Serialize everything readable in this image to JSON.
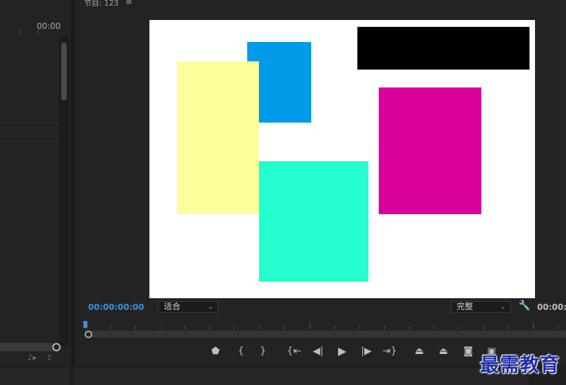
{
  "left_panel": {
    "ruler_time": "00:00",
    "icons": [
      "audio-to-track-icon",
      "export-icon"
    ]
  },
  "program": {
    "title": "节目: 123",
    "menu_icon": "hamburger-icon",
    "frame": {
      "background": "#ffffff",
      "rects": [
        {
          "name": "blue-rect",
          "color": "#009be8"
        },
        {
          "name": "yellow-rect",
          "color": "#fdfd9b"
        },
        {
          "name": "black-rect",
          "color": "#000000"
        },
        {
          "name": "magenta-rect",
          "color": "#d9009c"
        },
        {
          "name": "cyan-rect",
          "color": "#25ffcf"
        }
      ]
    },
    "timecode_left": "00:00:00:00",
    "zoom_select": "适合",
    "quality_select": "完整",
    "timecode_right": "00:00:"
  },
  "transport": [
    {
      "name": "add-marker-button",
      "icon": "marker-icon",
      "glyph": "⬟"
    },
    {
      "name": "mark-in-button",
      "icon": "mark-in-icon",
      "glyph": "{"
    },
    {
      "name": "mark-out-button",
      "icon": "mark-out-icon",
      "glyph": "}"
    },
    {
      "name": "go-to-in-button",
      "icon": "go-to-in-icon",
      "glyph": "{⇤"
    },
    {
      "name": "step-back-button",
      "icon": "step-back-icon",
      "glyph": "◀|"
    },
    {
      "name": "play-button",
      "icon": "play-icon",
      "glyph": "▶"
    },
    {
      "name": "step-forward-button",
      "icon": "step-forward-icon",
      "glyph": "|▶"
    },
    {
      "name": "go-to-out-button",
      "icon": "go-to-out-icon",
      "glyph": "⇥}"
    },
    {
      "name": "lift-button",
      "icon": "lift-icon",
      "glyph": "⏏"
    },
    {
      "name": "extract-button",
      "icon": "extract-icon",
      "glyph": "⏏"
    },
    {
      "name": "export-frame-button",
      "icon": "camera-icon",
      "glyph": "📷"
    },
    {
      "name": "comparison-view-button",
      "icon": "comparison-view-icon",
      "glyph": "▣"
    }
  ],
  "watermark": "最需教育"
}
